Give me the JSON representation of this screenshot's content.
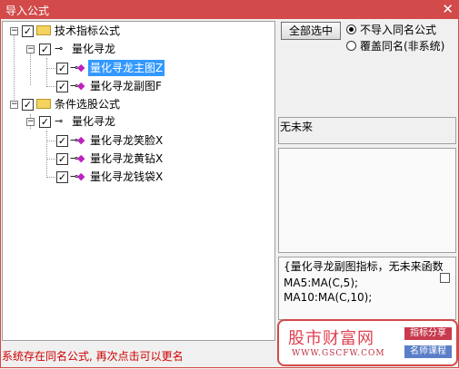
{
  "window": {
    "title": "导入公式",
    "close_glyph": "✕"
  },
  "tree": {
    "expander_minus": "−",
    "check_mark": "✓",
    "groups": [
      {
        "label": "技术指标公式",
        "sub": {
          "label": "量化寻龙",
          "items": [
            "量化寻龙主图Z",
            "量化寻龙副图F"
          ]
        }
      },
      {
        "label": "条件选股公式",
        "sub": {
          "label": "量化寻龙",
          "items": [
            "量化寻龙笑脸X",
            "量化寻龙黄钻X",
            "量化寻龙钱袋X"
          ]
        }
      }
    ]
  },
  "options": {
    "select_all_label": "全部选中",
    "radio_no_import": "不导入同名公式",
    "radio_overwrite": "覆盖同名(非系统)"
  },
  "info": {
    "future_text": "无未来"
  },
  "code": {
    "lines": [
      "{量化寻龙副图指标，无未来函数",
      "MA5:MA(C,5);",
      "MA10:MA(C,10);"
    ]
  },
  "status": {
    "message": "系统存在同名公式, 再次点击可以更名"
  },
  "watermark": {
    "title": "股市财富网",
    "url": "WWW.GSCFW.COM",
    "tag1": "指标分享",
    "tag2": "名师课程",
    "tag1_color": "#c83a4e",
    "tag2_color": "#5a7ec8"
  },
  "colors": {
    "accent": "#d24a4a",
    "selection": "#3399ff"
  }
}
